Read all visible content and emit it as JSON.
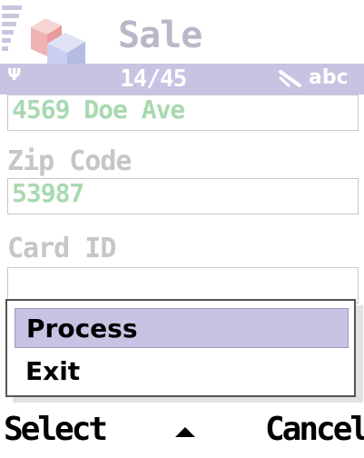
{
  "header": {
    "title": "Sale",
    "app_icon": "stacked-cubes-icon",
    "signal_icon": "signal-strength-icon"
  },
  "status": {
    "antenna_icon": "antenna-icon",
    "counter": "14/45",
    "pen_icon": "pen-icon",
    "input_mode": "abc",
    "strip_color": "#c6c3e3"
  },
  "form": {
    "address_value": "4569 Doe Ave",
    "zip_label": "Zip Code",
    "zip_value": "53987",
    "card_label": "Card ID",
    "card_value": "",
    "value_color": "#a8d9b0",
    "label_color": "#c6c6c6"
  },
  "menu": {
    "items": [
      {
        "label": "Process",
        "selected": true
      },
      {
        "label": "Exit",
        "selected": false
      }
    ],
    "highlight_color": "#c6c3e3"
  },
  "softkeys": {
    "left": "Select",
    "center_icon": "up-arrow-icon",
    "right": "Cancel"
  }
}
